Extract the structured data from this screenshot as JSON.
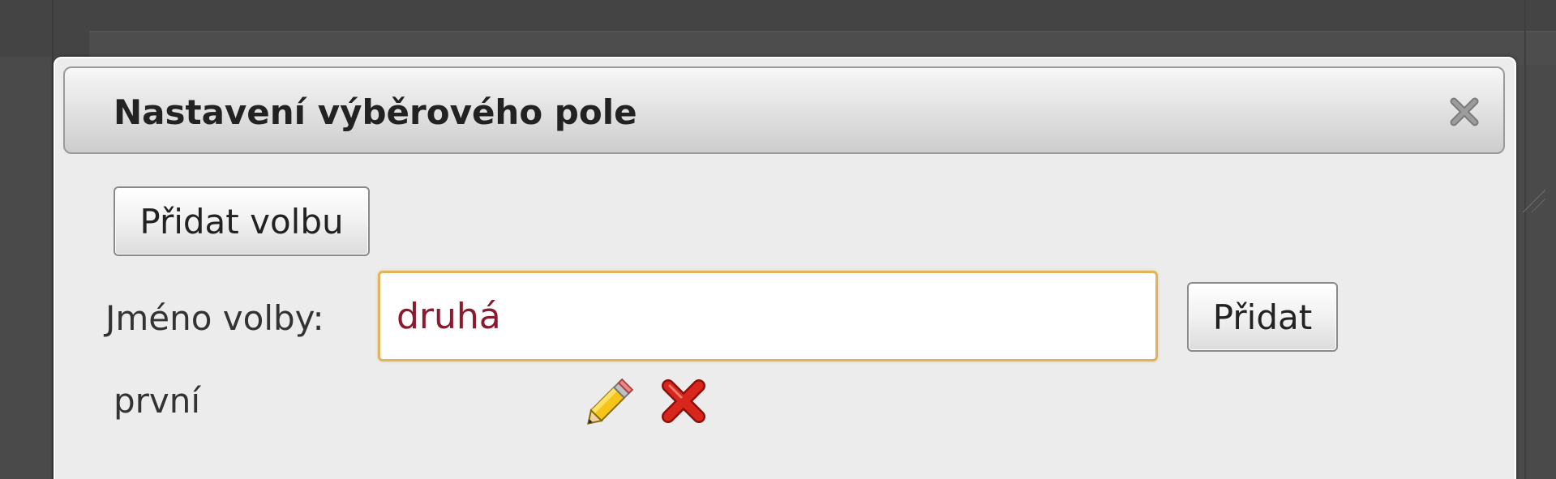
{
  "dialog": {
    "title": "Nastavení výběrového pole",
    "close_icon": "close-icon"
  },
  "toolbar": {
    "add_option_label": "Přidat volbu"
  },
  "form": {
    "field_label": "Jméno volby:",
    "input_value": "druhá",
    "submit_label": "Přidat"
  },
  "options": {
    "items": [
      {
        "label": "první",
        "edit_icon": "pencil-icon",
        "delete_icon": "delete-x-icon"
      }
    ]
  },
  "colors": {
    "input_border": "#e0b35c",
    "input_text": "#8b1a2e",
    "delete_red": "#d9261c"
  }
}
